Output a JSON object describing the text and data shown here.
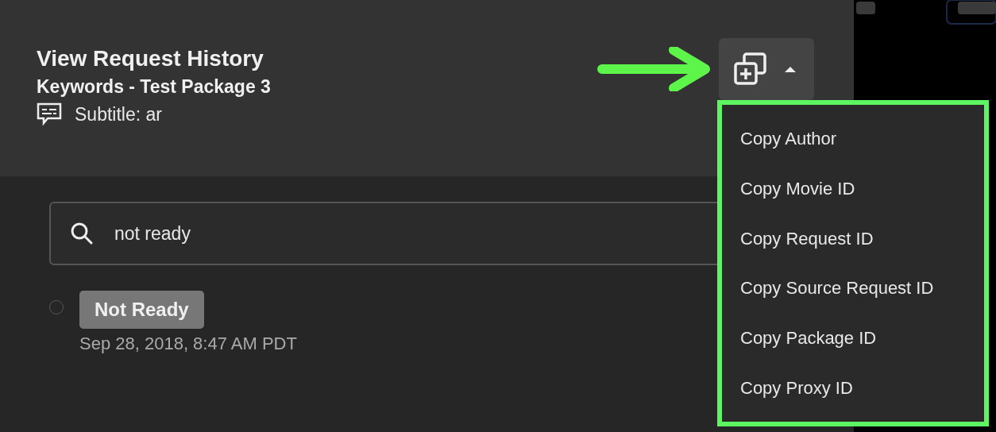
{
  "header": {
    "title": "View Request History",
    "subtitle": "Keywords - Test Package 3",
    "caption": "Subtitle: ar"
  },
  "copy_button": {
    "expanded": true
  },
  "copy_menu": {
    "items": [
      {
        "label": "Copy Author"
      },
      {
        "label": "Copy Movie ID"
      },
      {
        "label": "Copy Request ID"
      },
      {
        "label": "Copy Source Request ID"
      },
      {
        "label": "Copy Package ID"
      },
      {
        "label": "Copy Proxy ID"
      }
    ]
  },
  "search": {
    "value": "not ready"
  },
  "history": [
    {
      "status": "Not Ready",
      "time": "Sep 28, 2018, 8:47 AM PDT",
      "selected": false
    }
  ]
}
